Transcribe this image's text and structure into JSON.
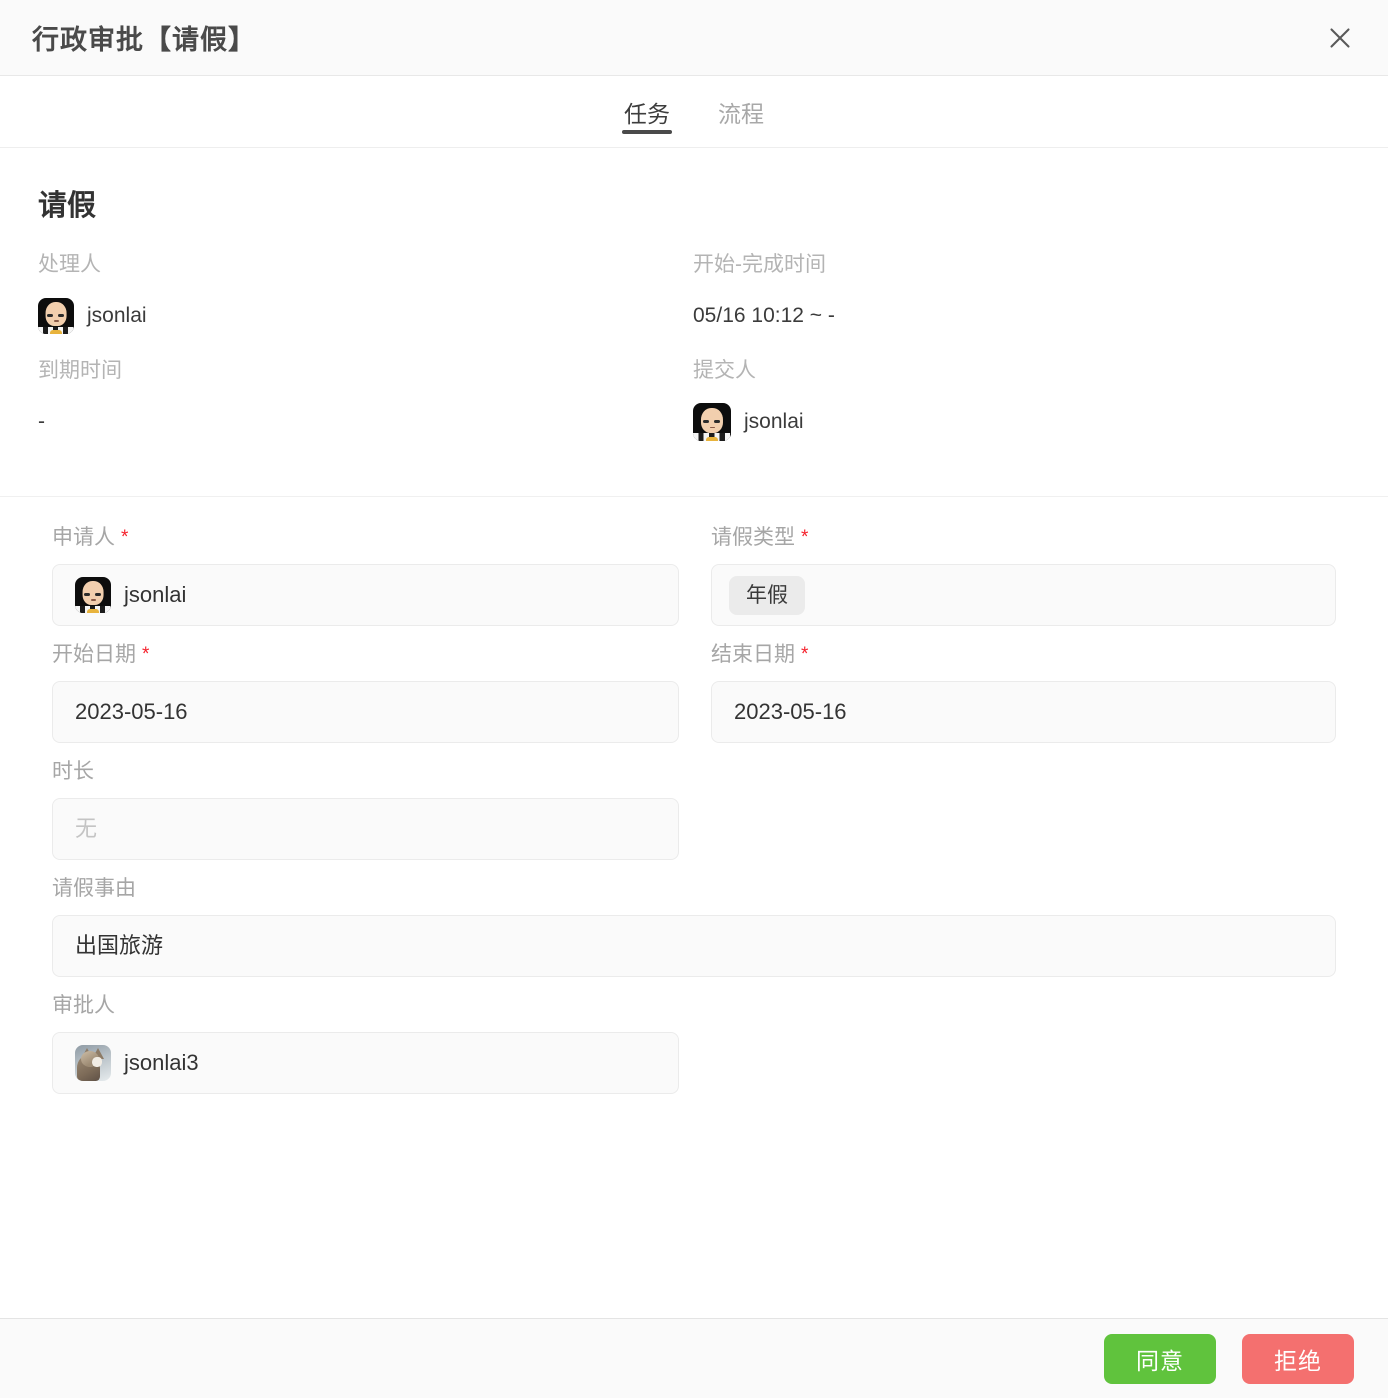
{
  "header": {
    "title": "行政审批【请假】",
    "close_icon": "close-icon"
  },
  "tabs": [
    {
      "label": "任务",
      "active": true
    },
    {
      "label": "流程",
      "active": false
    }
  ],
  "summary": {
    "title": "请假",
    "fields": [
      {
        "label": "处理人",
        "value": "jsonlai",
        "type": "user",
        "avatar": "saitama-avatar"
      },
      {
        "label": "开始-完成时间",
        "value": "05/16 10:12 ~ -",
        "type": "text"
      },
      {
        "label": "到期时间",
        "value": "-",
        "type": "text"
      },
      {
        "label": "提交人",
        "value": "jsonlai",
        "type": "user",
        "avatar": "saitama-avatar"
      }
    ]
  },
  "form": {
    "applicant": {
      "label": "申请人",
      "required": "*",
      "value": "jsonlai",
      "avatar": "saitama-avatar"
    },
    "leave_type": {
      "label": "请假类型",
      "required": "*",
      "tag": "年假"
    },
    "start_date": {
      "label": "开始日期",
      "required": "*",
      "value": "2023-05-16"
    },
    "end_date": {
      "label": "结束日期",
      "required": "*",
      "value": "2023-05-16"
    },
    "duration": {
      "label": "时长",
      "placeholder": "无",
      "value": ""
    },
    "reason": {
      "label": "请假事由",
      "value": "出国旅游"
    },
    "approver": {
      "label": "审批人",
      "value": "jsonlai3",
      "avatar": "cat-avatar"
    }
  },
  "footer": {
    "approve_label": "同意",
    "reject_label": "拒绝"
  },
  "colors": {
    "approve": "#60c33d",
    "reject": "#f4706f",
    "required_mark": "#f5222d",
    "header_bg": "#fafafa",
    "field_bg": "#fafafa"
  }
}
